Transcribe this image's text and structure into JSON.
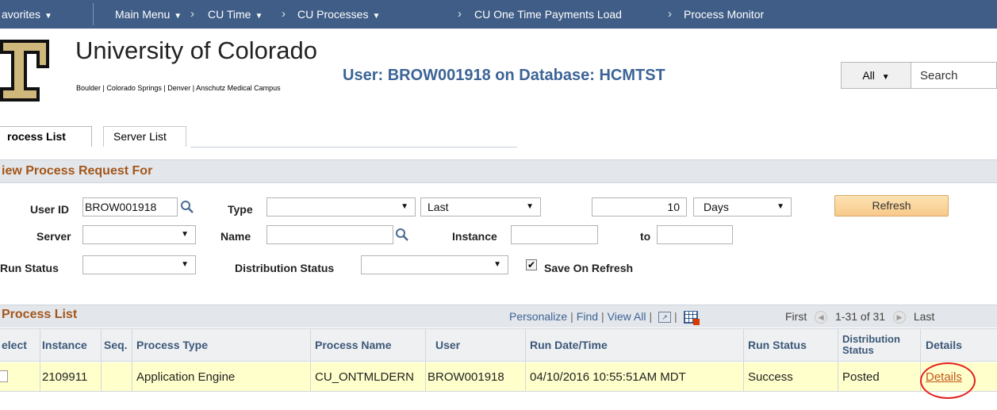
{
  "navbar": {
    "favorites": "avorites",
    "main_menu": "Main Menu",
    "crumbs": [
      "CU Time",
      "CU Processes",
      "CU One Time Payments Load",
      "Process Monitor"
    ]
  },
  "header": {
    "org_name": "University of Colorado",
    "campuses": "Boulder | Colorado Springs | Denver | Anschutz Medical Campus",
    "user_db": "User: BROW001918 on Database: HCMTST",
    "search_scope": "All",
    "search_placeholder": "Search"
  },
  "tabs": {
    "process_list": "rocess List",
    "server_list": "Server List"
  },
  "request": {
    "title": "iew Process Request For",
    "user_id_label": "User ID",
    "user_id_value": "BROW001918",
    "type_label": "Type",
    "type_value": "",
    "last_value": "Last",
    "days_count": "10",
    "days_unit": "Days",
    "refresh_label": "Refresh",
    "server_label": "Server",
    "name_label": "Name",
    "instance_label": "Instance",
    "to_label": "to",
    "run_status_label": "Run Status",
    "dist_status_label": "Distribution Status",
    "save_on_refresh_label": "Save On Refresh",
    "save_on_refresh_checked": true
  },
  "grid": {
    "title": "Process List",
    "personalize": "Personalize",
    "find": "Find",
    "view_all": "View All",
    "first": "First",
    "range": "1-31 of 31",
    "last": "Last",
    "columns": {
      "select": "elect",
      "instance": "Instance",
      "seq": "Seq.",
      "process_type": "Process Type",
      "process_name": "Process Name",
      "user": "User",
      "run_datetime": "Run Date/Time",
      "run_status": "Run Status",
      "dist_status": "Distribution Status",
      "details": "Details"
    },
    "rows": [
      {
        "instance": "2109911",
        "seq": "",
        "process_type": "Application Engine",
        "process_name": "CU_ONTMLDERN",
        "user": "BROW001918",
        "run_datetime": "04/10/2016 10:55:51AM MDT",
        "run_status": "Success",
        "dist_status": "Posted",
        "details": "Details"
      }
    ]
  },
  "colors": {
    "navbar": "#3f5d86",
    "section_title": "#a4561a",
    "link": "#3c6496",
    "row_highlight": "#ffffcc",
    "annotation_circle": "#e41e1e"
  }
}
